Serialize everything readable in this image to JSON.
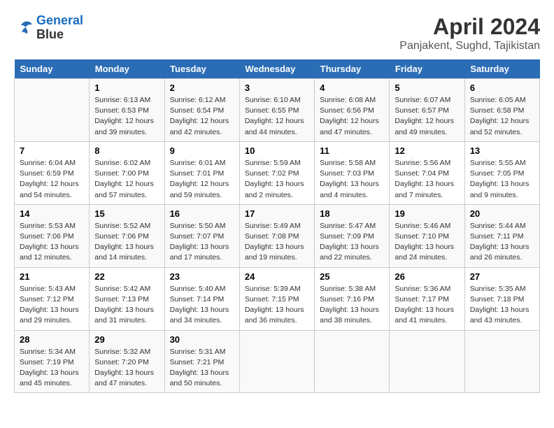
{
  "header": {
    "logo_line1": "General",
    "logo_line2": "Blue",
    "title": "April 2024",
    "subtitle": "Panjakent, Sughd, Tajikistan"
  },
  "weekdays": [
    "Sunday",
    "Monday",
    "Tuesday",
    "Wednesday",
    "Thursday",
    "Friday",
    "Saturday"
  ],
  "weeks": [
    [
      {
        "day": "",
        "info": ""
      },
      {
        "day": "1",
        "info": "Sunrise: 6:13 AM\nSunset: 6:53 PM\nDaylight: 12 hours\nand 39 minutes."
      },
      {
        "day": "2",
        "info": "Sunrise: 6:12 AM\nSunset: 6:54 PM\nDaylight: 12 hours\nand 42 minutes."
      },
      {
        "day": "3",
        "info": "Sunrise: 6:10 AM\nSunset: 6:55 PM\nDaylight: 12 hours\nand 44 minutes."
      },
      {
        "day": "4",
        "info": "Sunrise: 6:08 AM\nSunset: 6:56 PM\nDaylight: 12 hours\nand 47 minutes."
      },
      {
        "day": "5",
        "info": "Sunrise: 6:07 AM\nSunset: 6:57 PM\nDaylight: 12 hours\nand 49 minutes."
      },
      {
        "day": "6",
        "info": "Sunrise: 6:05 AM\nSunset: 6:58 PM\nDaylight: 12 hours\nand 52 minutes."
      }
    ],
    [
      {
        "day": "7",
        "info": "Sunrise: 6:04 AM\nSunset: 6:59 PM\nDaylight: 12 hours\nand 54 minutes."
      },
      {
        "day": "8",
        "info": "Sunrise: 6:02 AM\nSunset: 7:00 PM\nDaylight: 12 hours\nand 57 minutes."
      },
      {
        "day": "9",
        "info": "Sunrise: 6:01 AM\nSunset: 7:01 PM\nDaylight: 12 hours\nand 59 minutes."
      },
      {
        "day": "10",
        "info": "Sunrise: 5:59 AM\nSunset: 7:02 PM\nDaylight: 13 hours\nand 2 minutes."
      },
      {
        "day": "11",
        "info": "Sunrise: 5:58 AM\nSunset: 7:03 PM\nDaylight: 13 hours\nand 4 minutes."
      },
      {
        "day": "12",
        "info": "Sunrise: 5:56 AM\nSunset: 7:04 PM\nDaylight: 13 hours\nand 7 minutes."
      },
      {
        "day": "13",
        "info": "Sunrise: 5:55 AM\nSunset: 7:05 PM\nDaylight: 13 hours\nand 9 minutes."
      }
    ],
    [
      {
        "day": "14",
        "info": "Sunrise: 5:53 AM\nSunset: 7:06 PM\nDaylight: 13 hours\nand 12 minutes."
      },
      {
        "day": "15",
        "info": "Sunrise: 5:52 AM\nSunset: 7:06 PM\nDaylight: 13 hours\nand 14 minutes."
      },
      {
        "day": "16",
        "info": "Sunrise: 5:50 AM\nSunset: 7:07 PM\nDaylight: 13 hours\nand 17 minutes."
      },
      {
        "day": "17",
        "info": "Sunrise: 5:49 AM\nSunset: 7:08 PM\nDaylight: 13 hours\nand 19 minutes."
      },
      {
        "day": "18",
        "info": "Sunrise: 5:47 AM\nSunset: 7:09 PM\nDaylight: 13 hours\nand 22 minutes."
      },
      {
        "day": "19",
        "info": "Sunrise: 5:46 AM\nSunset: 7:10 PM\nDaylight: 13 hours\nand 24 minutes."
      },
      {
        "day": "20",
        "info": "Sunrise: 5:44 AM\nSunset: 7:11 PM\nDaylight: 13 hours\nand 26 minutes."
      }
    ],
    [
      {
        "day": "21",
        "info": "Sunrise: 5:43 AM\nSunset: 7:12 PM\nDaylight: 13 hours\nand 29 minutes."
      },
      {
        "day": "22",
        "info": "Sunrise: 5:42 AM\nSunset: 7:13 PM\nDaylight: 13 hours\nand 31 minutes."
      },
      {
        "day": "23",
        "info": "Sunrise: 5:40 AM\nSunset: 7:14 PM\nDaylight: 13 hours\nand 34 minutes."
      },
      {
        "day": "24",
        "info": "Sunrise: 5:39 AM\nSunset: 7:15 PM\nDaylight: 13 hours\nand 36 minutes."
      },
      {
        "day": "25",
        "info": "Sunrise: 5:38 AM\nSunset: 7:16 PM\nDaylight: 13 hours\nand 38 minutes."
      },
      {
        "day": "26",
        "info": "Sunrise: 5:36 AM\nSunset: 7:17 PM\nDaylight: 13 hours\nand 41 minutes."
      },
      {
        "day": "27",
        "info": "Sunrise: 5:35 AM\nSunset: 7:18 PM\nDaylight: 13 hours\nand 43 minutes."
      }
    ],
    [
      {
        "day": "28",
        "info": "Sunrise: 5:34 AM\nSunset: 7:19 PM\nDaylight: 13 hours\nand 45 minutes."
      },
      {
        "day": "29",
        "info": "Sunrise: 5:32 AM\nSunset: 7:20 PM\nDaylight: 13 hours\nand 47 minutes."
      },
      {
        "day": "30",
        "info": "Sunrise: 5:31 AM\nSunset: 7:21 PM\nDaylight: 13 hours\nand 50 minutes."
      },
      {
        "day": "",
        "info": ""
      },
      {
        "day": "",
        "info": ""
      },
      {
        "day": "",
        "info": ""
      },
      {
        "day": "",
        "info": ""
      }
    ]
  ]
}
